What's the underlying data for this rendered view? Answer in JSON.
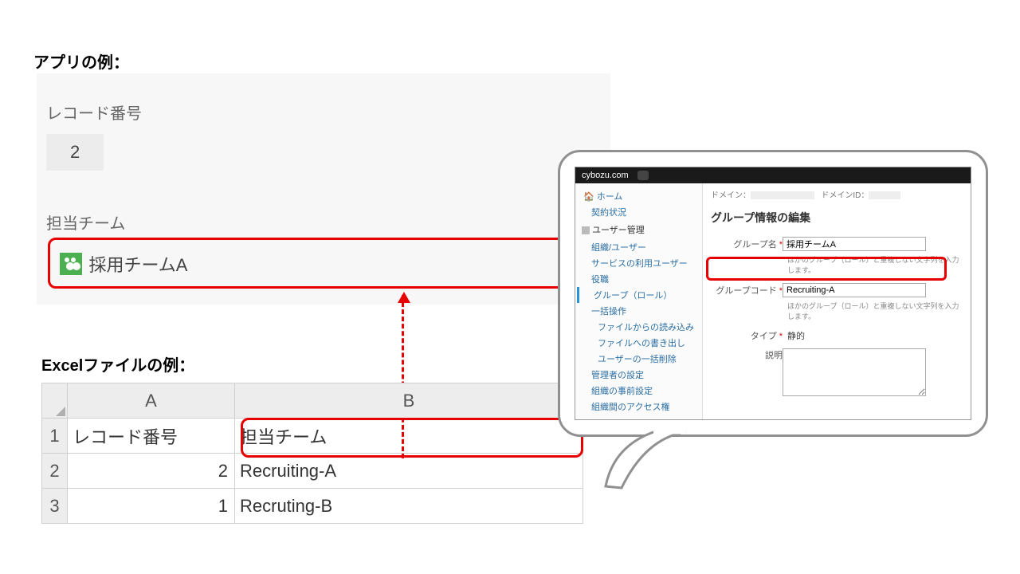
{
  "headings": {
    "app": "アプリの例：",
    "excel": "Excelファイルの例："
  },
  "app": {
    "record_label": "レコード番号",
    "record_value": "2",
    "team_label": "担当チーム",
    "team_value": "採用チームA"
  },
  "excel": {
    "col_a": "A",
    "col_b": "B",
    "rows": [
      {
        "n": "1",
        "a": "レコード番号",
        "b": "担当チーム"
      },
      {
        "n": "2",
        "a": "2",
        "b": "Recruiting-A"
      },
      {
        "n": "3",
        "a": "1",
        "b": "Recruting-B"
      }
    ]
  },
  "admin": {
    "brand": "cybozu.com",
    "domain_label": "ドメイン：",
    "domain_id_label": "ドメインID：",
    "side": {
      "home": "ホーム",
      "contract": "契約状況",
      "user_mgmt_header": "ユーザー管理",
      "org_user": "組織/ユーザー",
      "service_users": "サービスの利用ユーザー",
      "positions": "役職",
      "group_role": "グループ（ロール）",
      "bulk": "一括操作",
      "file_read": "ファイルからの読み込み",
      "file_write": "ファイルへの書き出し",
      "bulk_delete": "ユーザーの一括削除",
      "admin_settings": "管理者の設定",
      "org_presets": "組織の事前設定",
      "org_access": "組織間のアクセス権"
    },
    "form": {
      "title": "グループ情報の編集",
      "group_name_label": "グループ名",
      "group_name_value": "採用チームA",
      "hint1": "ほかのグループ（ロール）と重複しない文字列を入力します。",
      "group_code_label": "グループコード",
      "group_code_value": "Recruiting-A",
      "hint2": "ほかのグループ（ロール）と重複しない文字列を入力します。",
      "type_label": "タイプ",
      "type_value": "静的",
      "desc_label": "説明"
    }
  }
}
